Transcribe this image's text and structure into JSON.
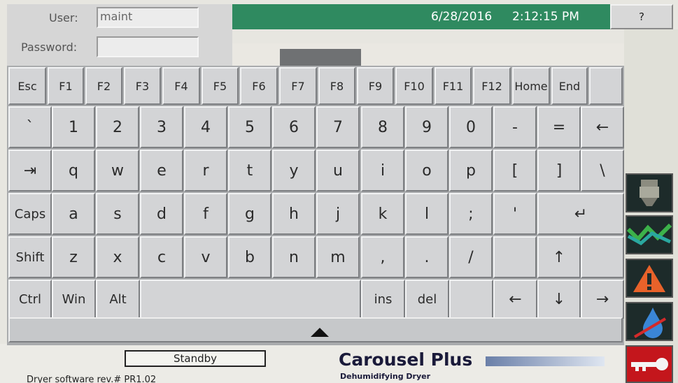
{
  "topbar": {
    "date": "6/28/2016",
    "time": "2:12:15 PM",
    "help_label": "?"
  },
  "login": {
    "user_label": "User:",
    "user_value": "maint",
    "password_label": "Password:",
    "password_value": ""
  },
  "keyboard": {
    "row1": [
      "Esc",
      "F1",
      "F2",
      "F3",
      "F4",
      "F5",
      "F6",
      "F7",
      "F8",
      "F9",
      "F10",
      "F11",
      "F12",
      "Home",
      "End",
      ""
    ],
    "row2": [
      "`",
      "1",
      "2",
      "3",
      "4",
      "5",
      "6",
      "7",
      "8",
      "9",
      "0",
      "-",
      "=",
      "←"
    ],
    "row3": [
      "⇥",
      "q",
      "w",
      "e",
      "r",
      "t",
      "y",
      "u",
      "i",
      "o",
      "p",
      "[",
      "]",
      "\\"
    ],
    "row4": [
      "Caps",
      "a",
      "s",
      "d",
      "f",
      "g",
      "h",
      "j",
      "k",
      "l",
      ";",
      "'",
      "↵"
    ],
    "row5": [
      "Shift",
      "z",
      "x",
      "c",
      "v",
      "b",
      "n",
      "m",
      ",",
      ".",
      "/",
      "",
      "↑",
      ""
    ],
    "row6": [
      "Ctrl",
      "Win",
      "Alt",
      "",
      "ins",
      "del",
      "",
      "←",
      "↓",
      "→"
    ]
  },
  "status": {
    "mode": "Standby",
    "software_rev": "Dryer software rev.# PR1.02",
    "brand": "Carousel Plus",
    "brand_sub": "Dehumidifying Dryer"
  },
  "side_buttons": [
    "hopper-icon",
    "trend-icon",
    "alarm-icon",
    "water-icon",
    "key-icon"
  ],
  "colors": {
    "topbar": "#2f8a60",
    "keyboard_bg": "#a9abad",
    "key_face": "#d3d4d6",
    "alarm": "#e8622a",
    "key_icon": "#d42a2a"
  }
}
